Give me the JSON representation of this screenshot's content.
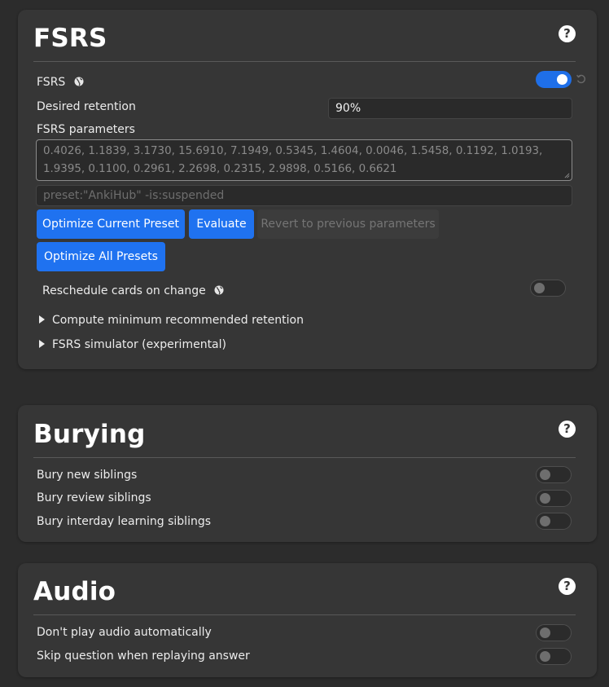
{
  "fsrs_section": {
    "title": "FSRS",
    "help_label": "?",
    "fsrs_toggle_label": "FSRS",
    "fsrs_enabled": true,
    "desired_retention_label": "Desired retention",
    "desired_retention_value": "90%",
    "parameters_label": "FSRS parameters",
    "parameters_value": "0.4026, 1.1839, 3.1730, 15.6910, 7.1949, 0.5345, 1.4604, 0.0046, 1.5458, 0.1192, 1.0193, 1.9395, 0.1100, 0.2961, 2.2698, 0.2315, 2.9898, 0.5166, 0.6621",
    "search_placeholder": "preset:\"AnkiHub\" -is:suspended",
    "optimize_current_label": "Optimize Current Preset",
    "evaluate_label": "Evaluate",
    "revert_label": "Revert to previous parameters",
    "optimize_all_label": "Optimize All Presets",
    "reschedule_label": "Reschedule cards on change",
    "reschedule_enabled": false,
    "compute_min_label": "Compute minimum recommended retention",
    "simulator_label": "FSRS simulator (experimental)"
  },
  "burying_section": {
    "title": "Burying",
    "help_label": "?",
    "bury_new_label": "Bury new siblings",
    "bury_review_label": "Bury review siblings",
    "bury_interday_label": "Bury interday learning siblings"
  },
  "audio_section": {
    "title": "Audio",
    "help_label": "?",
    "no_autoplay_label": "Don't play audio automatically",
    "skip_question_label": "Skip question when replaying answer"
  },
  "colors": {
    "accent": "#1f72f0",
    "card_bg": "#363636",
    "page_bg": "#2c2c2c"
  }
}
